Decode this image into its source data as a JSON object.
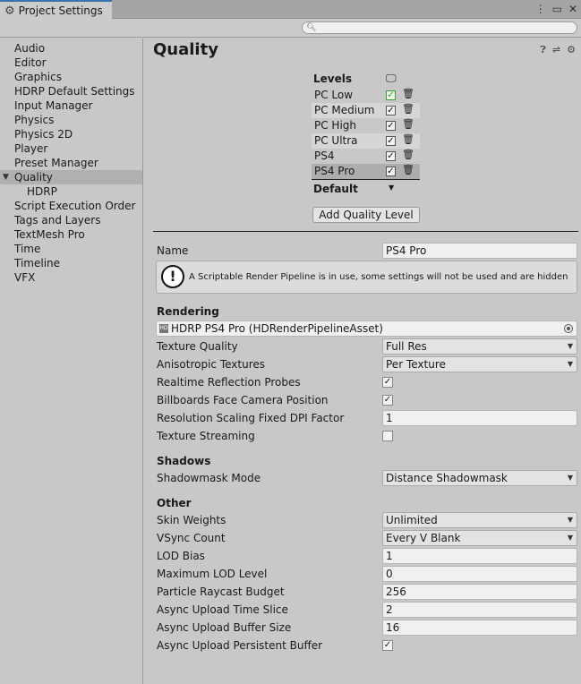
{
  "window": {
    "tab_title": "Project Settings",
    "menu_icon": "kebab-menu-icon",
    "maximize_icon": "maximize-icon",
    "close_icon": "close-icon"
  },
  "search": {
    "placeholder": "",
    "icon": "search-icon"
  },
  "sidebar": {
    "items": [
      {
        "label": "Audio"
      },
      {
        "label": "Editor"
      },
      {
        "label": "Graphics"
      },
      {
        "label": "HDRP Default Settings"
      },
      {
        "label": "Input Manager"
      },
      {
        "label": "Physics"
      },
      {
        "label": "Physics 2D"
      },
      {
        "label": "Player"
      },
      {
        "label": "Preset Manager"
      },
      {
        "label": "Quality",
        "selected": true,
        "expanded": true
      },
      {
        "label": "HDRP",
        "indent": 1
      },
      {
        "label": "Script Execution Order"
      },
      {
        "label": "Tags and Layers"
      },
      {
        "label": "TextMesh Pro"
      },
      {
        "label": "Time"
      },
      {
        "label": "Timeline"
      },
      {
        "label": "VFX"
      }
    ]
  },
  "main": {
    "title": "Quality",
    "header_icons": [
      "help-icon",
      "presets-icon",
      "settings-gear-icon"
    ],
    "levels": {
      "title": "Levels",
      "platform_icon": "monitor-icon",
      "rows": [
        {
          "name": "PC Low",
          "checked": true,
          "default": true
        },
        {
          "name": "PC Medium",
          "checked": true
        },
        {
          "name": "PC High",
          "checked": true
        },
        {
          "name": "PC Ultra",
          "checked": true
        },
        {
          "name": "PS4",
          "checked": true
        },
        {
          "name": "PS4 Pro",
          "checked": true,
          "selected": true
        }
      ],
      "default_label": "Default",
      "add_button": "Add Quality Level"
    },
    "name": {
      "label": "Name",
      "value": "PS4 Pro"
    },
    "help_message": "A Scriptable Render Pipeline is in use, some settings will not be used and are hidden",
    "rendering": {
      "title": "Rendering",
      "pipeline_asset": "HDRP PS4 Pro (HDRenderPipelineAsset)",
      "texture_quality": {
        "label": "Texture Quality",
        "value": "Full Res"
      },
      "anisotropic": {
        "label": "Anisotropic Textures",
        "value": "Per Texture"
      },
      "realtime_reflection": {
        "label": "Realtime Reflection Probes",
        "checked": true
      },
      "billboards": {
        "label": "Billboards Face Camera Position",
        "checked": true
      },
      "resolution_scaling": {
        "label": "Resolution Scaling Fixed DPI Factor",
        "value": "1"
      },
      "texture_streaming": {
        "label": "Texture Streaming",
        "checked": false
      }
    },
    "shadows": {
      "title": "Shadows",
      "shadowmask": {
        "label": "Shadowmask Mode",
        "value": "Distance Shadowmask"
      }
    },
    "other": {
      "title": "Other",
      "skin_weights": {
        "label": "Skin Weights",
        "value": "Unlimited"
      },
      "vsync": {
        "label": "VSync Count",
        "value": "Every V Blank"
      },
      "lod_bias": {
        "label": "LOD Bias",
        "value": "1"
      },
      "max_lod": {
        "label": "Maximum LOD Level",
        "value": "0"
      },
      "particle_raycast": {
        "label": "Particle Raycast Budget",
        "value": "256"
      },
      "async_time_slice": {
        "label": "Async Upload Time Slice",
        "value": "2"
      },
      "async_buffer_size": {
        "label": "Async Upload Buffer Size",
        "value": "16"
      },
      "async_persistent": {
        "label": "Async Upload Persistent Buffer",
        "checked": true
      }
    }
  }
}
